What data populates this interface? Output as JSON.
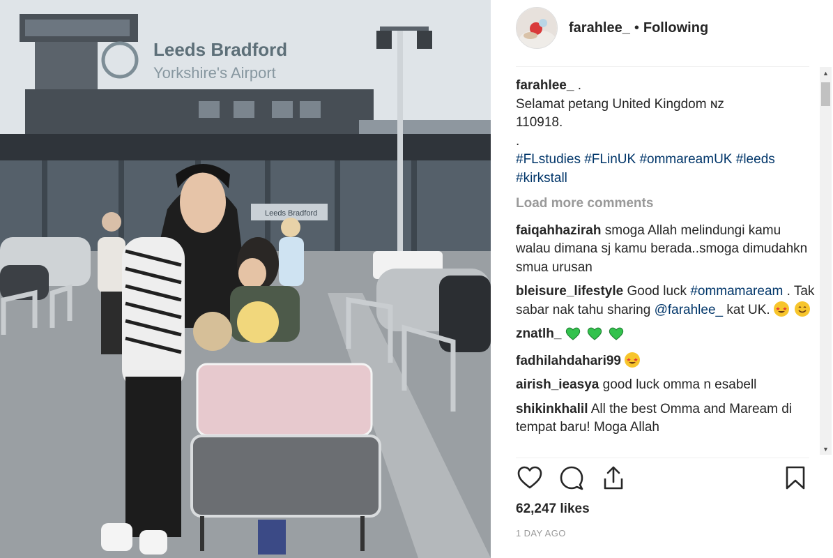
{
  "photo": {
    "sign_line1": "Leeds Bradford",
    "sign_line2": "Yorkshire's Airport",
    "door_sign": "Leeds Bradford"
  },
  "header": {
    "username": "farahlee_",
    "separator": "•",
    "follow_status": "Following"
  },
  "caption": {
    "username": "farahlee_",
    "lines": [
      ".",
      "Selamat petang United Kingdom ɴᴢ",
      "110918.",
      "."
    ],
    "hashtags": [
      "#FLstudies",
      "#FLinUK",
      "#ommareamUK",
      "#leeds",
      "#kirkstall"
    ]
  },
  "load_more": "Load more comments",
  "comments": [
    {
      "username": "faiqahhazirah",
      "text": "smoga Allah melindungi kamu walau dimana sj kamu berada..smoga dimudahkn smua urusan"
    },
    {
      "username": "bleisure_lifestyle",
      "text_a": "Good luck",
      "tag": "#ommamaream",
      "text_b": ". Tak sabar nak tahu sharing",
      "mention": "@farahlee_",
      "text_c": "kat UK."
    },
    {
      "username": "znatlh_",
      "text": ""
    },
    {
      "username": "fadhilahdahari99",
      "text": ""
    },
    {
      "username": "airish_ieasya",
      "text": "good luck omma n esabell"
    },
    {
      "username": "shikinkhalil",
      "text": "All the best Omma and Maream di tempat baru! Moga Allah"
    }
  ],
  "icons": {
    "like": "heart-outline-icon",
    "comment": "speech-bubble-icon",
    "share": "share-icon",
    "save": "bookmark-icon"
  },
  "likes": "62,247 likes",
  "timestamp": "1 DAY AGO",
  "colors": {
    "link": "#003569",
    "muted": "#999999",
    "text": "#262626"
  }
}
